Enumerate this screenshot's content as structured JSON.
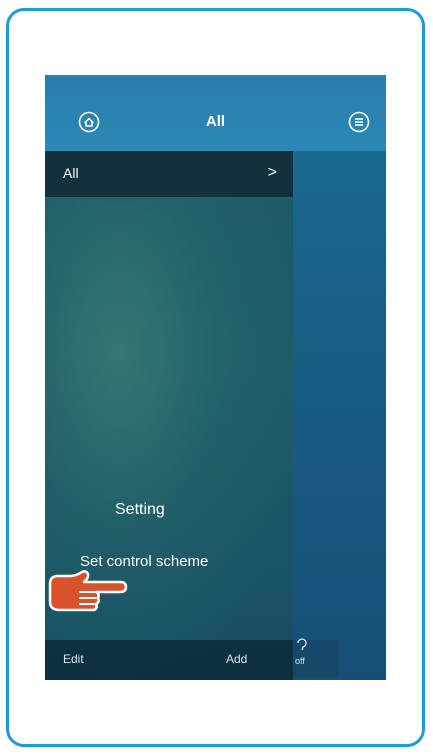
{
  "header": {
    "title": "All"
  },
  "icons": {
    "left": "home-circle-icon",
    "right": "menu-circle-icon",
    "pointer": "pointing-hand-icon"
  },
  "drawer": {
    "header_label": "All",
    "header_chevron": ">",
    "menu_items": [
      "Setting",
      "Set control scheme"
    ]
  },
  "bottom_bar": {
    "edit_label": "Edit",
    "add_label": "Add"
  },
  "right_tile": {
    "text": "off"
  },
  "colors": {
    "frame": "#1e9ad6",
    "hand_fill": "#d9522b"
  }
}
